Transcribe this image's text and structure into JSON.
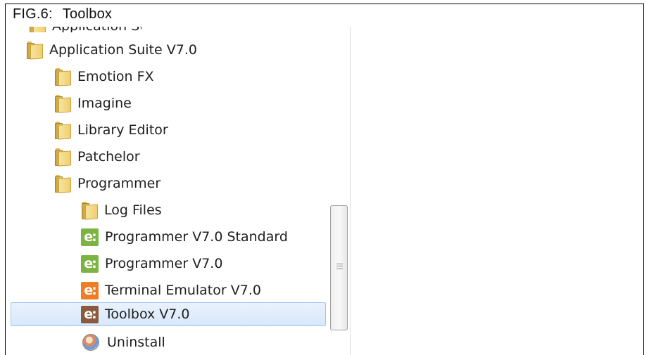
{
  "figure": {
    "label": "FIG.6:",
    "title": "Toolbox"
  },
  "start_menu": {
    "partial_item": {
      "label": "Application Suite",
      "icon": "folder-icon"
    },
    "items": [
      {
        "label": "Application Suite V7.0",
        "icon": "folder-icon",
        "level": 0
      },
      {
        "label": "Emotion FX",
        "icon": "folder-icon",
        "level": 1
      },
      {
        "label": "Imagine",
        "icon": "folder-icon",
        "level": 1
      },
      {
        "label": "Library Editor",
        "icon": "folder-icon",
        "level": 1
      },
      {
        "label": "Patchelor",
        "icon": "folder-icon",
        "level": 1
      },
      {
        "label": "Programmer",
        "icon": "folder-icon",
        "level": 1
      },
      {
        "label": "Log Files",
        "icon": "folder-icon",
        "level": 2
      },
      {
        "label": "Programmer V7.0 Standard",
        "icon": "programmer-app-icon",
        "level": 2
      },
      {
        "label": "Programmer V7.0",
        "icon": "programmer-app-icon",
        "level": 2
      },
      {
        "label": "Terminal Emulator V7.0",
        "icon": "terminal-app-icon",
        "level": 2
      },
      {
        "label": "Toolbox V7.0",
        "icon": "toolbox-app-icon",
        "level": 2,
        "selected": true
      },
      {
        "label": "Uninstall",
        "icon": "uninstall-icon",
        "level": 2
      }
    ],
    "app_icon_glyph": "e:",
    "colors": {
      "programmer_icon": "#7cb342",
      "terminal_icon": "#ef7d22",
      "toolbox_icon": "#8a5a3c",
      "selection_border": "#9fc4ef",
      "selection_fill": "#dde9fb"
    }
  }
}
